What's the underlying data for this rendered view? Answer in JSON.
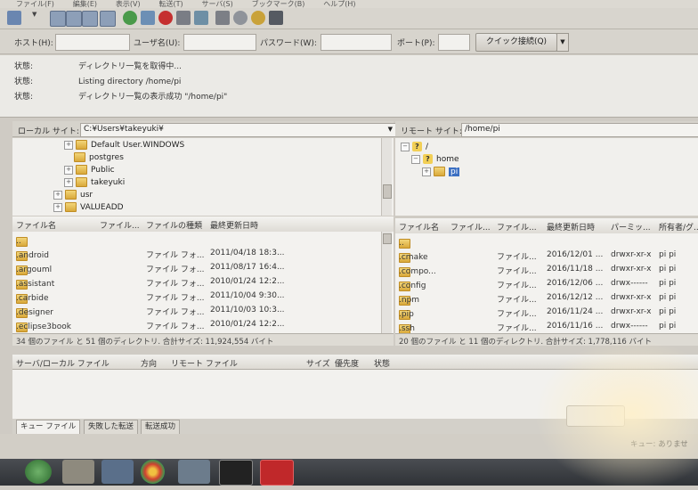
{
  "menu": [
    "ファイル(F)",
    "編集(E)",
    "表示(V)",
    "転送(T)",
    "サーバ(S)",
    "ブックマーク(B)",
    "ヘルプ(H)"
  ],
  "toolbar_icons": [
    "site-manager-icon",
    "toggle-log-icon",
    "toggle-local-tree-icon",
    "toggle-remote-tree-icon",
    "toggle-queue-icon",
    "refresh-icon",
    "process-queue-icon",
    "cancel-icon",
    "disconnect-icon",
    "reconnect-icon",
    "filter-icon",
    "compare-icon",
    "sync-browse-icon",
    "find-icon"
  ],
  "quickconnect": {
    "host_label": "ホスト(H):",
    "user_label": "ユーザ名(U):",
    "password_label": "パスワード(W):",
    "port_label": "ポート(P):",
    "connect_button": "クイック接続(Q)",
    "host_value": "",
    "user_value": "",
    "password_value": "",
    "port_value": ""
  },
  "log": [
    {
      "kind": "状態:",
      "text": "ディレクトリ一覧を取得中..."
    },
    {
      "kind": "状態:",
      "text": "Listing directory /home/pi"
    },
    {
      "kind": "状態:",
      "text": "ディレクトリ一覧の表示成功 \"/home/pi\""
    }
  ],
  "local": {
    "site_label": "ローカル サイト:",
    "path": "C:¥Users¥takeyuki¥",
    "tree": [
      "Default User.WINDOWS",
      "postgres",
      "Public",
      "takeyuki",
      "usr",
      "VALUEADD"
    ],
    "columns": [
      "ファイル名",
      "ファイル...",
      "ファイルの種類",
      "最終更新日時"
    ],
    "files": [
      {
        "name": "..",
        "type": "",
        "date": ""
      },
      {
        "name": ".android",
        "type": "ファイル フォ...",
        "date": "2011/04/18 18:3..."
      },
      {
        "name": ".argouml",
        "type": "ファイル フォ...",
        "date": "2011/08/17 16:4..."
      },
      {
        "name": ".assistant",
        "type": "ファイル フォ...",
        "date": "2010/01/24 12:2..."
      },
      {
        "name": ".carbide",
        "type": "ファイル フォ...",
        "date": "2011/10/04 9:30..."
      },
      {
        "name": ".designer",
        "type": "ファイル フォ...",
        "date": "2011/10/03 10:3..."
      },
      {
        "name": ".eclipse3book",
        "type": "ファイル フォ...",
        "date": "2010/01/24 12:2..."
      }
    ],
    "status": "34 個のファイル と 51 個のディレクトリ. 合計サイズ: 11,924,554 バイト"
  },
  "remote": {
    "site_label": "リモート サイト:",
    "path": "/home/pi",
    "tree": [
      "/",
      "home",
      "pi"
    ],
    "columns": [
      "ファイル名",
      "ファイル...",
      "ファイル...",
      "最終更新日時",
      "パーミッ...",
      "所有者/グ..."
    ],
    "files": [
      {
        "name": "..",
        "c2": "",
        "c3": "",
        "date": "",
        "perm": "",
        "owner": ""
      },
      {
        "name": ".cmake",
        "c2": "",
        "c3": "ファイル...",
        "date": "2016/12/01 ...",
        "perm": "drwxr-xr-x",
        "owner": "pi pi"
      },
      {
        "name": ".compo...",
        "c2": "",
        "c3": "ファイル...",
        "date": "2016/11/18 ...",
        "perm": "drwxr-xr-x",
        "owner": "pi pi"
      },
      {
        "name": ".config",
        "c2": "",
        "c3": "ファイル...",
        "date": "2016/12/06 ...",
        "perm": "drwx------",
        "owner": "pi pi"
      },
      {
        "name": ".npm",
        "c2": "",
        "c3": "ファイル...",
        "date": "2016/12/12 ...",
        "perm": "drwxr-xr-x",
        "owner": "pi pi"
      },
      {
        "name": ".pip",
        "c2": "",
        "c3": "ファイル...",
        "date": "2016/11/24 ...",
        "perm": "drwxr-xr-x",
        "owner": "pi pi"
      },
      {
        "name": ".ssh",
        "c2": "",
        "c3": "ファイル...",
        "date": "2016/11/16 ...",
        "perm": "drwx------",
        "owner": "pi pi"
      }
    ],
    "status": "20 個のファイル と 11 個のディレクトリ. 合計サイズ: 1,778,116 バイト"
  },
  "queue": {
    "columns": [
      "サーバ/ローカル ファイル",
      "方向",
      "リモート ファイル",
      "サイズ",
      "優先度",
      "状態"
    ],
    "tabs": [
      "キュー ファイル",
      "失敗した転送",
      "転送成功"
    ],
    "footer": "キュー: ありませ"
  },
  "taskbar_apps": [
    "start-orb-icon",
    "file-explorer-icon",
    "network-icon",
    "chrome-icon",
    "app-icon",
    "terminal-icon",
    "filezilla-icon"
  ]
}
